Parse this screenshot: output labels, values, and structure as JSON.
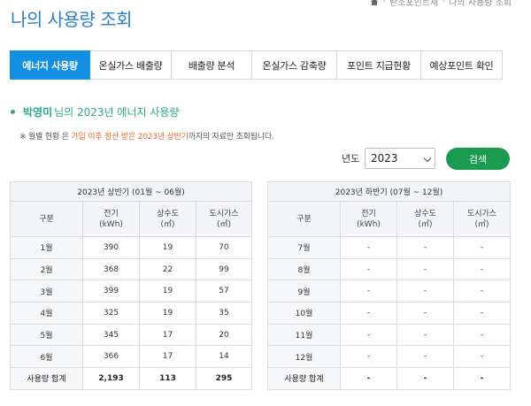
{
  "page": {
    "title": "나의 사용량 조회",
    "breadcrumb": [
      "홈",
      "탄소포인트제",
      "나의 사용량 조회"
    ]
  },
  "tabs": [
    {
      "label": "에너지 사용량",
      "active": true
    },
    {
      "label": "온실가스 배출량",
      "active": false
    },
    {
      "label": "배출량 분석",
      "active": false
    },
    {
      "label": "온실가스 감축량",
      "active": false
    },
    {
      "label": "포인트 지급현황",
      "active": false
    },
    {
      "label": "예상포인트 확인",
      "active": false
    }
  ],
  "heading": {
    "user_name": "박영미",
    "text": "님의 2023년 에너지 사용량"
  },
  "notice": {
    "prefix": "※ 월별 현황 은 ",
    "highlight": "가입 이후 정산 받은 2023년 상반기",
    "suffix": "까지의 자료만 조회됩니다."
  },
  "filter": {
    "year_label": "년도",
    "year_value": "2023",
    "search_label": "검색"
  },
  "columns": {
    "category": "구분",
    "electricity": [
      "전기",
      "(kWh)"
    ],
    "water": [
      "상수도",
      "(㎥)"
    ],
    "gas": [
      "도시가스",
      "(㎥)"
    ]
  },
  "first_half": {
    "caption": "2023년 상반기 (01월 ~ 06월)",
    "rows": [
      {
        "month": "1월",
        "electricity": "390",
        "water": "19",
        "gas": "70"
      },
      {
        "month": "2월",
        "electricity": "368",
        "water": "22",
        "gas": "99"
      },
      {
        "month": "3월",
        "electricity": "399",
        "water": "19",
        "gas": "57"
      },
      {
        "month": "4월",
        "electricity": "325",
        "water": "19",
        "gas": "35"
      },
      {
        "month": "5월",
        "electricity": "345",
        "water": "17",
        "gas": "20"
      },
      {
        "month": "6월",
        "electricity": "366",
        "water": "17",
        "gas": "14"
      }
    ],
    "total": {
      "label": "사용량 합계",
      "electricity": "2,193",
      "water": "113",
      "gas": "295"
    }
  },
  "second_half": {
    "caption": "2023년 하반기 (07월 ~ 12월)",
    "rows": [
      {
        "month": "7월",
        "electricity": "-",
        "water": "-",
        "gas": "-"
      },
      {
        "month": "8월",
        "electricity": "-",
        "water": "-",
        "gas": "-"
      },
      {
        "month": "9월",
        "electricity": "-",
        "water": "-",
        "gas": "-"
      },
      {
        "month": "10월",
        "electricity": "-",
        "water": "-",
        "gas": "-"
      },
      {
        "month": "11월",
        "electricity": "-",
        "water": "-",
        "gas": "-"
      },
      {
        "month": "12월",
        "electricity": "-",
        "water": "-",
        "gas": "-"
      }
    ],
    "total": {
      "label": "사용량 합계",
      "electricity": "-",
      "water": "-",
      "gas": "-"
    }
  },
  "colors": {
    "title": "#2a7fc9",
    "tab_active": "#1390e2",
    "heading": "#2ba88c",
    "notice_highlight": "#e36b2a",
    "search_button": "#1a9b4f"
  },
  "icons": {
    "breadcrumb_home": "home-icon",
    "select_arrow": "chevron-down-icon"
  }
}
